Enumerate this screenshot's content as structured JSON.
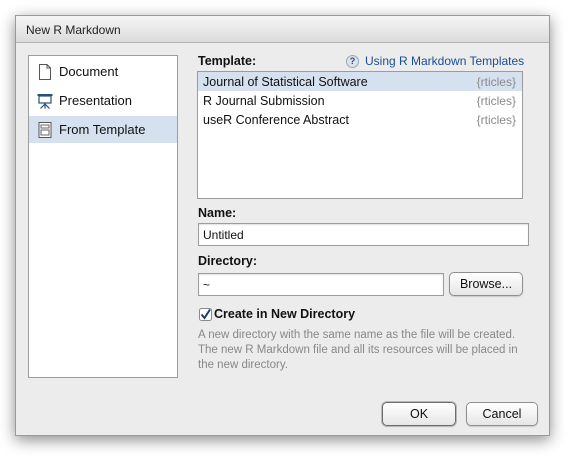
{
  "window": {
    "title": "New R Markdown"
  },
  "types": [
    {
      "label": "Document",
      "icon": "document-icon"
    },
    {
      "label": "Presentation",
      "icon": "presentation-icon"
    },
    {
      "label": "From Template",
      "icon": "template-icon",
      "selected": true
    }
  ],
  "template": {
    "label": "Template:",
    "help_link": "Using R Markdown Templates",
    "help_icon": "?",
    "items": [
      {
        "name": "Journal of Statistical Software",
        "package": "{rticles}",
        "selected": true
      },
      {
        "name": "R Journal Submission",
        "package": "{rticles}"
      },
      {
        "name": "useR Conference Abstract",
        "package": "{rticles}"
      }
    ]
  },
  "name": {
    "label": "Name:",
    "value": "Untitled"
  },
  "directory": {
    "label": "Directory:",
    "value": "~",
    "browse_label": "Browse..."
  },
  "create_dir": {
    "label": "Create in New Directory",
    "checked": true,
    "help": "A new directory with the same name as the file will be created. The new R Markdown file and all its resources will be placed in the new directory."
  },
  "buttons": {
    "ok": "OK",
    "cancel": "Cancel"
  },
  "colors": {
    "selection": "#d5e1ee",
    "link": "#1a4f94",
    "dialog_bg": "#ececec"
  }
}
